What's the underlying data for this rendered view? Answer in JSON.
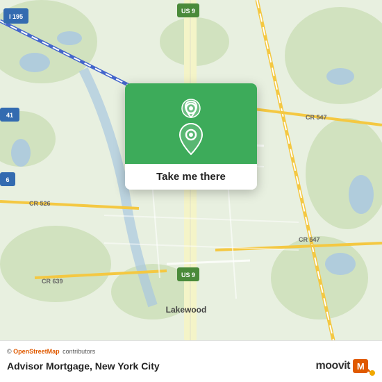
{
  "map": {
    "background_color": "#e8f0e0"
  },
  "popup": {
    "button_label": "Take me there",
    "pin_color": "#ffffff"
  },
  "bottom_bar": {
    "attribution_prefix": "©",
    "attribution_link_text": "OpenStreetMap",
    "attribution_suffix": "contributors",
    "location_text": "Advisor Mortgage, New York City",
    "moovit_text": "moovit"
  },
  "road_labels": [
    "I 195",
    "US 9",
    "41",
    "6",
    "CR 526",
    "CR 547",
    "CR 639",
    "CR 547",
    "US 9",
    "US 9",
    "Lakewood"
  ],
  "icons": {
    "pin": "📍",
    "moovit_colors": [
      "#e05a00",
      "#f0a800"
    ]
  }
}
